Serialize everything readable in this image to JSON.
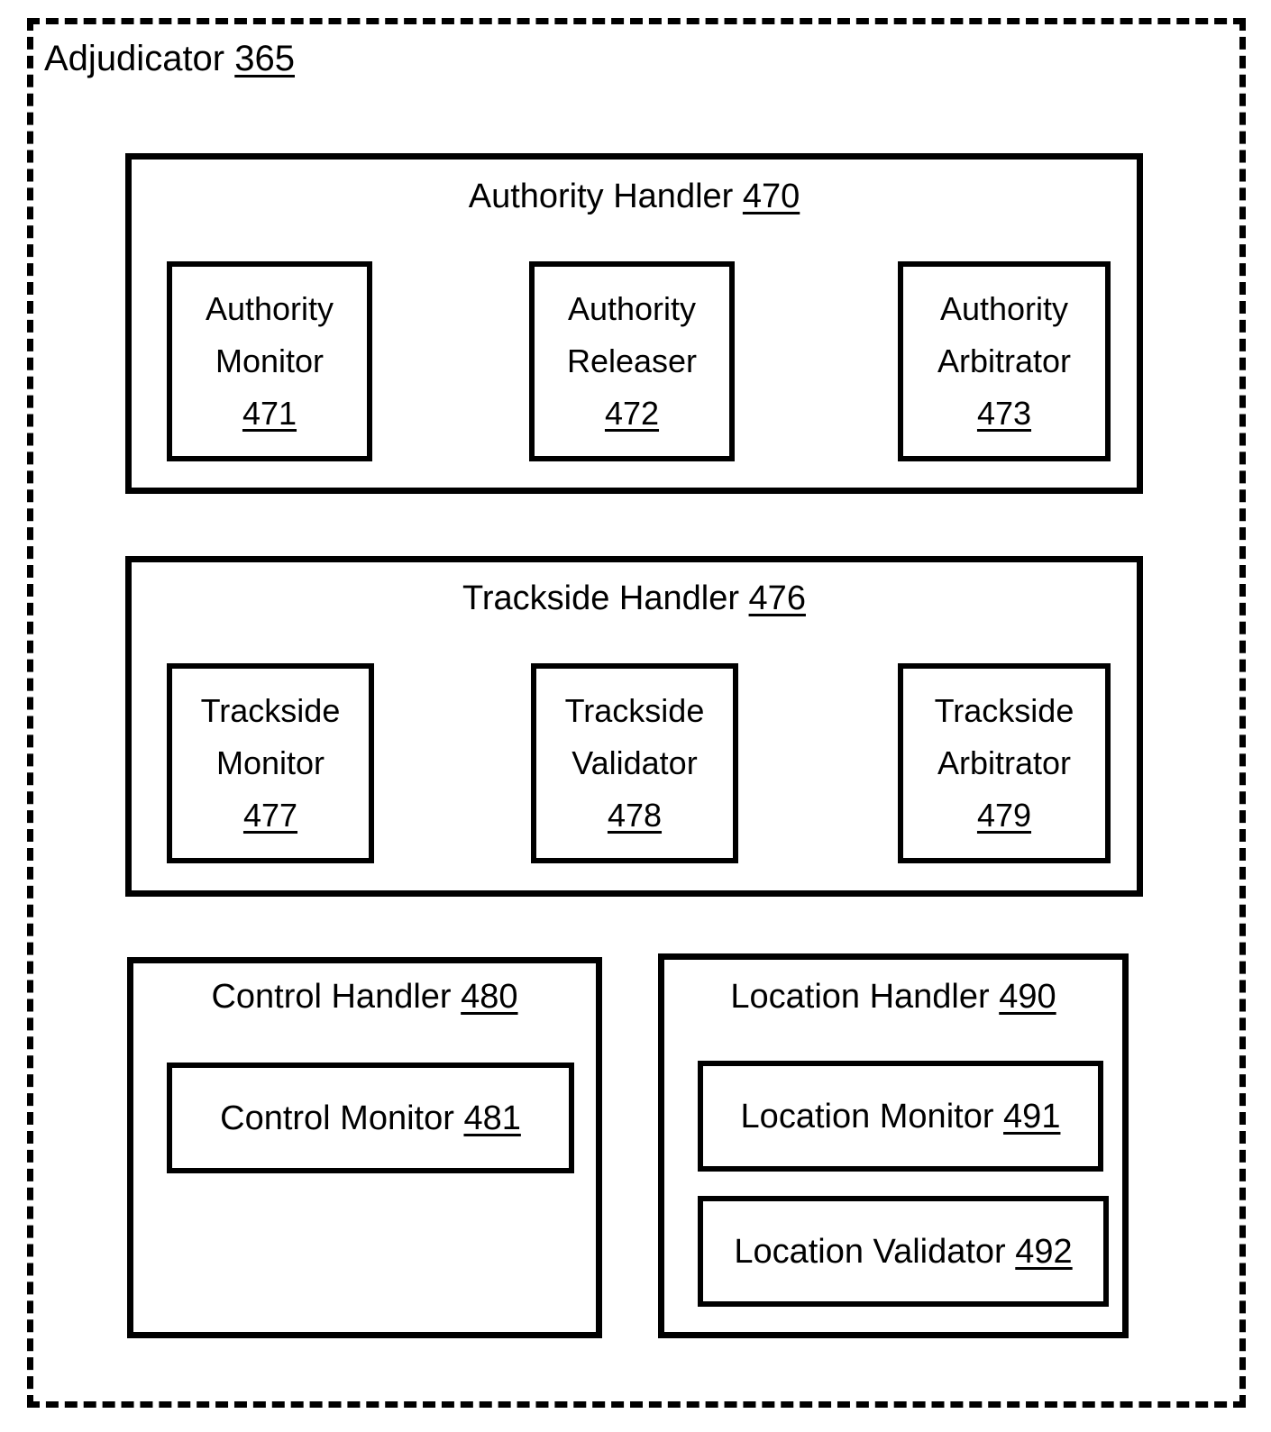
{
  "figure": {
    "root": {
      "label": "Adjudicator",
      "ref": "365"
    },
    "sections": [
      {
        "id": "authority-handler",
        "title_label": "Authority Handler",
        "title_ref": "470",
        "title_gap": "   ",
        "children": [
          {
            "id": "authority-monitor",
            "line1": "Authority",
            "line2": "Monitor",
            "ref": "471"
          },
          {
            "id": "authority-releaser",
            "line1": "Authority",
            "line2": "Releaser",
            "ref": "472"
          },
          {
            "id": "authority-arbitrator",
            "line1": "Authority",
            "line2": "Arbitrator",
            "ref": "473"
          }
        ]
      },
      {
        "id": "trackside-handler",
        "title_label": "Trackside Handler",
        "title_ref": "476",
        "title_gap": " ",
        "children": [
          {
            "id": "trackside-monitor",
            "line1": "Trackside",
            "line2": "Monitor",
            "ref": "477"
          },
          {
            "id": "trackside-validator",
            "line1": "Trackside",
            "line2": "Validator",
            "ref": "478"
          },
          {
            "id": "trackside-arbitrator",
            "line1": "Trackside",
            "line2": "Arbitrator",
            "ref": "479"
          }
        ]
      },
      {
        "id": "control-handler",
        "title_label": "Control Handler",
        "title_ref": "480",
        "title_gap": " ",
        "children": [
          {
            "id": "control-monitor",
            "line1": "Control Monitor",
            "ref": "481"
          }
        ]
      },
      {
        "id": "location-handler",
        "title_label": "Location Handler",
        "title_ref": "490",
        "title_gap": " ",
        "children": [
          {
            "id": "location-monitor",
            "line1": "Location Monitor",
            "ref": "491"
          },
          {
            "id": "location-validator",
            "line1": "Location Validator",
            "ref": "492"
          }
        ]
      }
    ],
    "colors": {
      "stroke": "#000000",
      "background": "#ffffff"
    }
  }
}
